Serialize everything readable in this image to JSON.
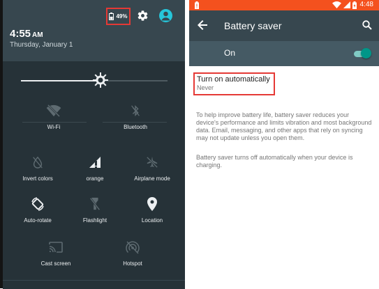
{
  "left": {
    "battery_percent": "49%",
    "clock_time": "4:55",
    "clock_ampm": "AM",
    "date": "Thursday, January 1",
    "brightness_level": 0.54,
    "tiles": [
      {
        "label": "Wi-Fi"
      },
      {
        "label": "Bluetooth"
      },
      {
        "label": "Invert colors"
      },
      {
        "label": "orange"
      },
      {
        "label": "Airplane mode"
      },
      {
        "label": "Auto-rotate"
      },
      {
        "label": "Flashlight"
      },
      {
        "label": "Location"
      },
      {
        "label": "Cast screen"
      },
      {
        "label": "Hotspot"
      }
    ]
  },
  "right": {
    "status_time": "4:48",
    "title": "Battery saver",
    "switch_label": "On",
    "switch_on": true,
    "auto_title": "Turn on automatically",
    "auto_value": "Never",
    "description_1": "To help improve battery life, battery saver reduces your device's performance and limits vibration and most background data. Email, messaging, and other apps that rely on syncing may not update unless you open them.",
    "description_2": "Battery saver turns off automatically when your device is charging."
  },
  "colors": {
    "status_bar": "#f4511e",
    "toolbar": "#37474f",
    "switch_bar": "#455a64",
    "accent": "#009688",
    "highlight": "#e53935",
    "avatar": "#26c6da"
  }
}
